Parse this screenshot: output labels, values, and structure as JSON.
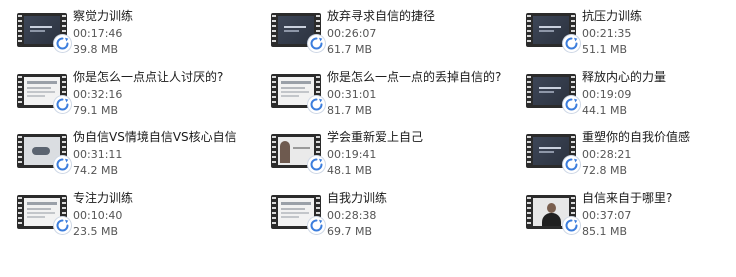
{
  "files": [
    {
      "title": "察觉力训练",
      "duration": "00:17:46",
      "size": "39.8 MB",
      "thumb": "dark"
    },
    {
      "title": "放弃寻求自信的捷径",
      "duration": "00:26:07",
      "size": "61.7 MB",
      "thumb": "dark"
    },
    {
      "title": "抗压力训练",
      "duration": "00:21:35",
      "size": "51.1 MB",
      "thumb": "dark"
    },
    {
      "title": "你是怎么一点点让人讨厌的?",
      "duration": "00:32:16",
      "size": "79.1 MB",
      "thumb": "light"
    },
    {
      "title": "你是怎么一点一点的丢掉自信的?",
      "duration": "00:31:01",
      "size": "81.7 MB",
      "thumb": "light"
    },
    {
      "title": "释放内心的力量",
      "duration": "00:19:09",
      "size": "44.1 MB",
      "thumb": "dark"
    },
    {
      "title": "伪自信VS情境自信VS核心自信",
      "duration": "00:31:11",
      "size": "74.2 MB",
      "thumb": "mid"
    },
    {
      "title": "学会重新爱上自己",
      "duration": "00:19:41",
      "size": "48.1 MB",
      "thumb": "photo"
    },
    {
      "title": "重塑你的自我价值感",
      "duration": "00:28:21",
      "size": "72.8 MB",
      "thumb": "dark"
    },
    {
      "title": "专注力训练",
      "duration": "00:10:40",
      "size": "23.5 MB",
      "thumb": "light"
    },
    {
      "title": "自我力训练",
      "duration": "00:28:38",
      "size": "69.7 MB",
      "thumb": "light"
    },
    {
      "title": "自信来自于哪里?",
      "duration": "00:37:07",
      "size": "85.1 MB",
      "thumb": "portrait"
    }
  ],
  "icons": {
    "thumbnail": "video-file-icon",
    "badge": "refresh-sync-icon"
  },
  "colors": {
    "title": "#1a1a1a",
    "meta": "#555555",
    "badge_accent": "#3b7ddd"
  }
}
